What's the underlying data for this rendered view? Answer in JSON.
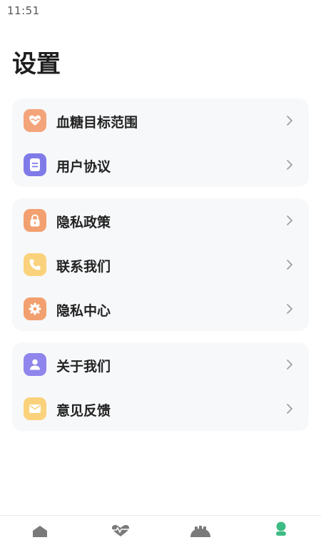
{
  "status_bar": {
    "time": "11:51"
  },
  "page": {
    "title": "设置"
  },
  "groups": [
    {
      "items": [
        {
          "label": "血糖目标范围",
          "icon": "heart-icon",
          "color": "#f4a47a"
        },
        {
          "label": "用户协议",
          "icon": "document-icon",
          "color": "#7f7ae8"
        }
      ]
    },
    {
      "items": [
        {
          "label": "隐私政策",
          "icon": "lock-icon",
          "color": "#f2a06f"
        },
        {
          "label": "联系我们",
          "icon": "phone-icon",
          "color": "#fbd27c"
        },
        {
          "label": "隐私中心",
          "icon": "gear-icon",
          "color": "#f2a06f"
        }
      ]
    },
    {
      "items": [
        {
          "label": "关于我们",
          "icon": "person-icon",
          "color": "#8f85ec"
        },
        {
          "label": "意见反馈",
          "icon": "mail-icon",
          "color": "#fbd27c"
        }
      ]
    }
  ],
  "bottom_nav": {
    "items": [
      {
        "icon": "home-icon"
      },
      {
        "icon": "pulse-icon"
      },
      {
        "icon": "device-icon"
      },
      {
        "icon": "profile-icon",
        "active_color": "#3dbb84"
      }
    ]
  }
}
